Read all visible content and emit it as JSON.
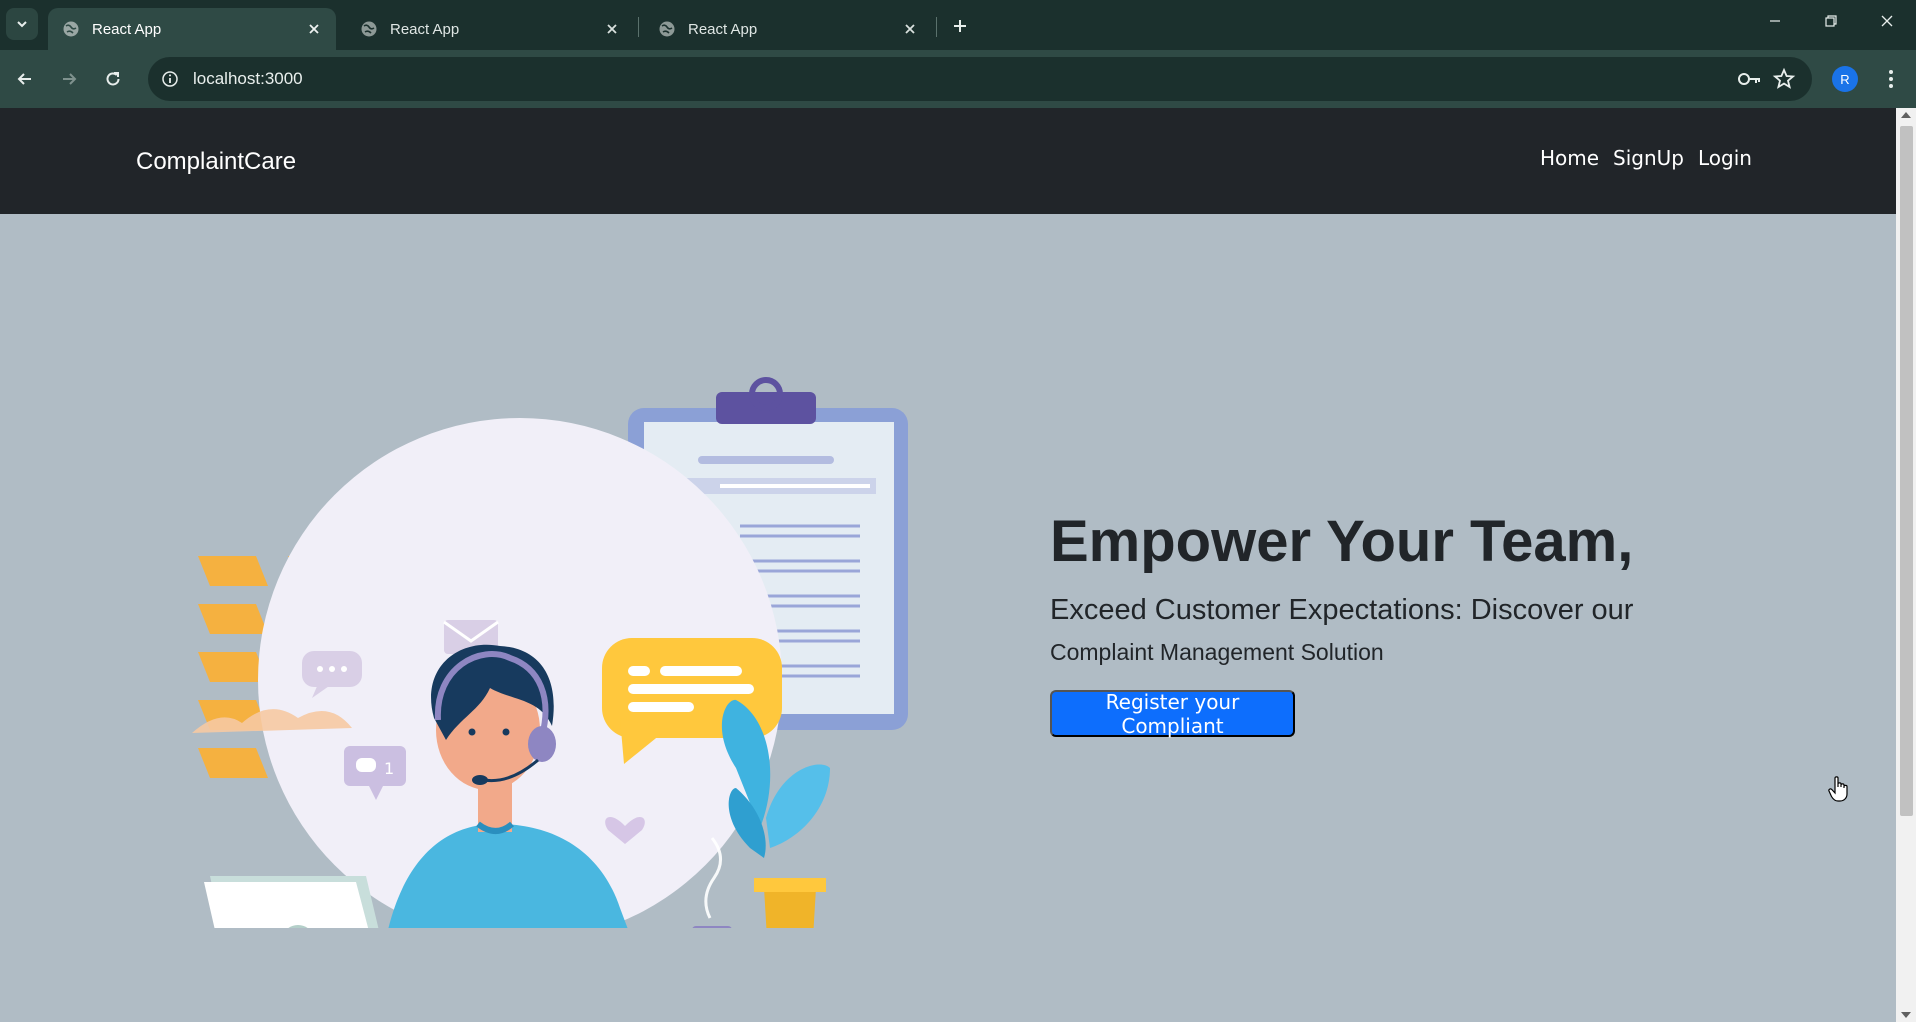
{
  "browser": {
    "tabs": [
      {
        "title": "React App",
        "active": true
      },
      {
        "title": "React App",
        "active": false
      },
      {
        "title": "React App",
        "active": false
      }
    ],
    "url": "localhost:3000",
    "profile_initial": "R",
    "icons": {
      "tab_search": "chevron-down-icon",
      "tab_favicon": "globe-icon",
      "tab_close": "close-icon",
      "new_tab": "plus-icon",
      "back": "arrow-left-icon",
      "forward": "arrow-right-icon",
      "reload": "reload-icon",
      "site_info": "info-icon",
      "passwords": "key-icon",
      "bookmark": "star-icon",
      "menu": "kebab-menu-icon",
      "minimize": "minimize-icon",
      "restore": "restore-icon",
      "close_window": "close-icon"
    }
  },
  "app": {
    "brand": "ComplaintCare",
    "nav": {
      "home": "Home",
      "signup": "SignUp",
      "login": "Login"
    },
    "hero": {
      "title": "Empower Your Team,",
      "subtitle_line1": "Exceed Customer Expectations: Discover our",
      "subtitle_line2": "Complaint Management Solution",
      "cta_label": "Register your Compliant",
      "illustration_badge": "1"
    }
  },
  "colors": {
    "chrome_dark": "#1b302d",
    "chrome_toolbar": "#2f4a45",
    "navbar_bg": "#212529",
    "page_bg": "#b0bcc5",
    "primary": "#0d6efd",
    "text_dark": "#212529"
  }
}
